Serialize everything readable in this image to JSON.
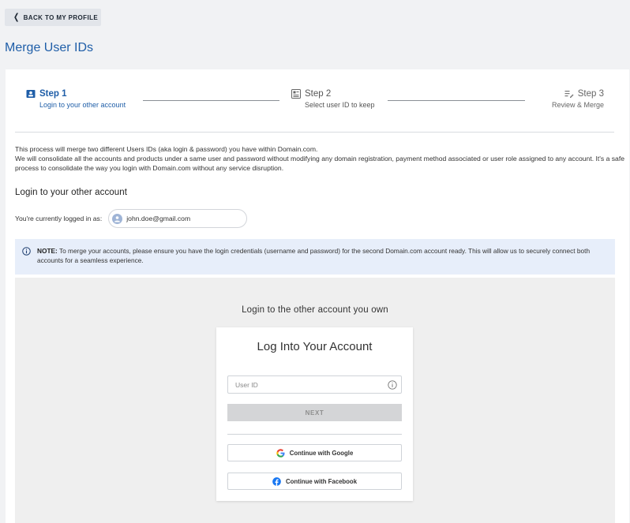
{
  "nav": {
    "back_label": "BACK TO MY PROFILE"
  },
  "page": {
    "title": "Merge User IDs"
  },
  "stepper": {
    "steps": [
      {
        "title": "Step 1",
        "subtitle": "Login to your other account"
      },
      {
        "title": "Step 2",
        "subtitle": "Select user ID to keep"
      },
      {
        "title": "Step 3",
        "subtitle": "Review & Merge"
      }
    ]
  },
  "intro": {
    "line1": "This process will merge two different Users IDs (aka login & password) you have within Domain.com.",
    "line2": "We will consolidate all the accounts and products under a same user and password without modifying any domain registration, payment method associated or user role assigned to any account. It's a safe process to consolidate the way you login with Domain.com without any service disruption."
  },
  "section": {
    "heading": "Login to your other account"
  },
  "session": {
    "logged_label": "You're currently logged in as:",
    "email": "john.doe@gmail.com"
  },
  "note": {
    "label": "NOTE:",
    "text": "To merge your accounts, please ensure you have the login credentials (username and password) for the second Domain.com account ready. This will allow us to securely connect both accounts for a seamless experience."
  },
  "login_panel": {
    "heading": "Login to the other account you own",
    "card_title": "Log Into Your Account",
    "user_id_placeholder": "User ID",
    "next_label": "NEXT",
    "google_label": "Continue with Google",
    "facebook_label": "Continue with Facebook"
  },
  "colors": {
    "accent": "#1f5ea8",
    "note_bg": "#e7eefa",
    "disabled_btn": "#d4d5d7"
  },
  "icons": [
    "chevron-left-icon",
    "id-card-icon",
    "list-icon",
    "edit-list-icon",
    "user-avatar-icon",
    "info-circle-icon",
    "google-icon",
    "facebook-icon"
  ]
}
